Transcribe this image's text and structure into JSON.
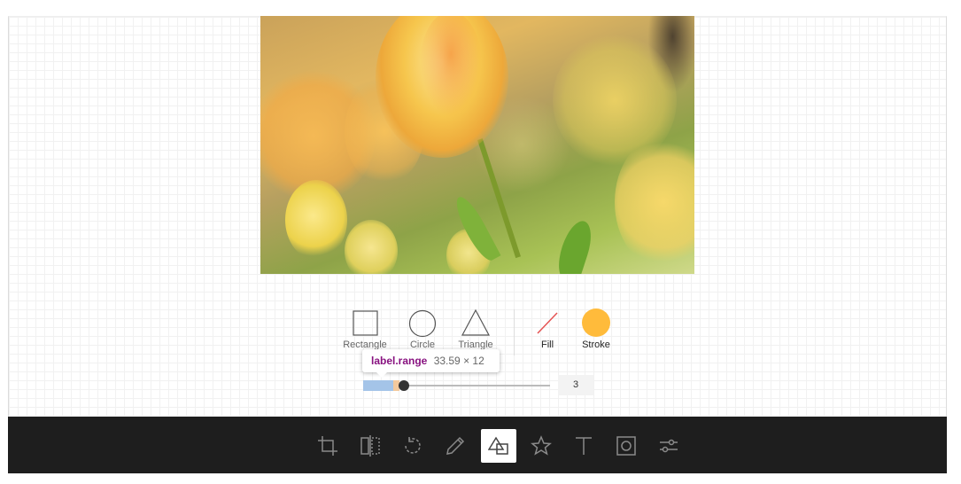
{
  "shapes": {
    "rectangle_label": "Rectangle",
    "circle_label": "Circle",
    "triangle_label": "Triangle"
  },
  "colors": {
    "fill_label": "Fill",
    "fill_value": "transparent",
    "stroke_label": "Stroke",
    "stroke_value": "#ffbb3b"
  },
  "tooltip": {
    "tag": "label.range",
    "dims": "33.59 × 12"
  },
  "range": {
    "value": "3",
    "level": 0.03
  },
  "toolbar": {
    "tools": [
      {
        "icon": "crop-icon",
        "active": false
      },
      {
        "icon": "flip-icon",
        "active": false
      },
      {
        "icon": "rotate-icon",
        "active": false
      },
      {
        "icon": "draw-icon",
        "active": false
      },
      {
        "icon": "shape-icon",
        "active": true
      },
      {
        "icon": "star-icon",
        "active": false
      },
      {
        "icon": "text-icon",
        "active": false
      },
      {
        "icon": "mask-icon",
        "active": false
      },
      {
        "icon": "filter-icon",
        "active": false
      }
    ]
  },
  "theme": {
    "toolbar_bg": "#1e1e1e",
    "accent": "#ffbb3b",
    "icon_color": "#8a8a8a"
  }
}
